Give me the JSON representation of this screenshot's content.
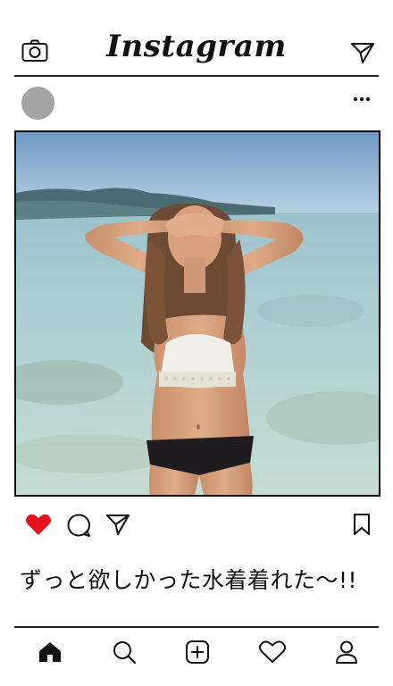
{
  "header": {
    "logo_text": "Instagram",
    "camera_icon": "camera-icon",
    "direct_icon": "paper-plane-icon"
  },
  "post": {
    "author_avatar": "avatar",
    "more_icon": "more-dots-icon",
    "image_description_icon": "photo",
    "liked": true,
    "like_color": "#e4131f",
    "caption": "ずっと欲しかった水着着れた〜!!"
  },
  "actions": {
    "like_icon": "heart-filled-icon",
    "comment_icon": "comment-bubble-icon",
    "share_icon": "paper-plane-icon",
    "save_icon": "bookmark-icon"
  },
  "bottom_nav": {
    "items": [
      {
        "icon": "home-icon",
        "active": true
      },
      {
        "icon": "search-icon",
        "active": false
      },
      {
        "icon": "add-post-icon",
        "active": false
      },
      {
        "icon": "heart-outline-icon",
        "active": false
      },
      {
        "icon": "profile-icon",
        "active": false
      }
    ]
  },
  "colors": {
    "background": "#ffffff",
    "ink": "#111111",
    "avatar_gray": "#a5a5a5"
  }
}
